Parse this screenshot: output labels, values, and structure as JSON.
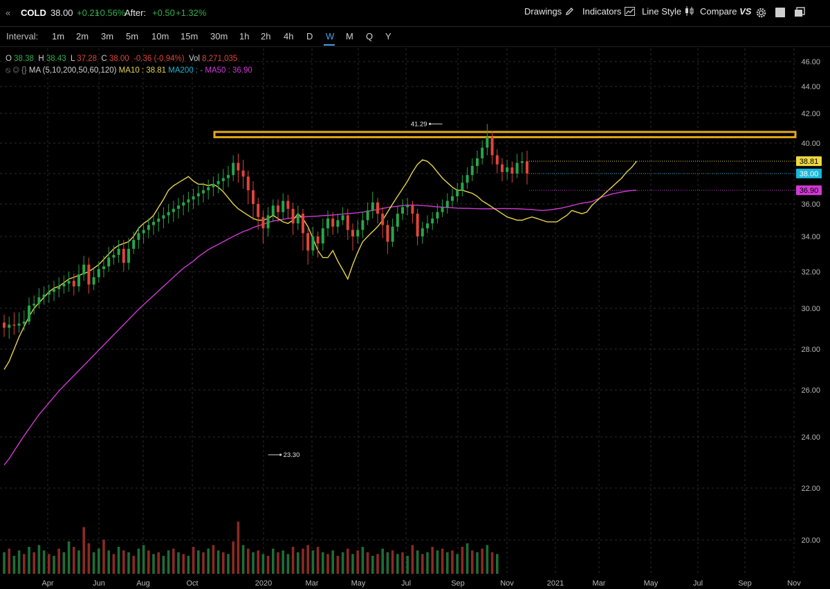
{
  "header": {
    "back_glyph": "«",
    "symbol": "COLD",
    "price": "38.00",
    "change": "+0.21",
    "change_pct": "+0.56%",
    "after_label": "After:",
    "after_change": "+0.50",
    "after_pct": "+1.32%",
    "buttons": {
      "drawings": "Drawings",
      "indicators": "Indicators",
      "line_style": "Line Style",
      "compare": "Compare",
      "compare_suffix": "VS"
    }
  },
  "intervals": {
    "label": "Interval:",
    "items": [
      "1m",
      "2m",
      "3m",
      "5m",
      "10m",
      "15m",
      "30m",
      "1h",
      "2h",
      "4h",
      "D",
      "W",
      "M",
      "Q",
      "Y"
    ],
    "active": "W"
  },
  "ohlc": {
    "o_label": "O",
    "o": "38.38",
    "h_label": "H",
    "h": "38.43",
    "l_label": "L",
    "l": "37.28",
    "c_label": "C",
    "c": "38.00",
    "chg": "-0.36 (-0.94%)",
    "vol_label": "Vol",
    "vol": "8,271,035"
  },
  "ma_line": {
    "icons": "⦸ ◎ {}",
    "ma_def": "MA (5,10,200,50,60,120)",
    "ma10": "MA10 : 38.81",
    "ma200": "MA200 : -",
    "ma50": "MA50 : 36.90"
  },
  "colors": {
    "up": "#26a64a",
    "down": "#e0453a",
    "ma10": "#e8d44d",
    "ma50": "#d23ad6",
    "resistance": "#e6a817",
    "last_price": "#17b8d8",
    "ma10_tag": "#f0d840"
  },
  "chart_data": {
    "type": "candlestick",
    "symbol": "COLD",
    "interval": "W",
    "ylim": [
      19.2,
      46.5
    ],
    "y_ticks": [
      20,
      22,
      24,
      26,
      28,
      30,
      32,
      34,
      36,
      38,
      40,
      42,
      44,
      46
    ],
    "y_tick_labels": [
      "20.00",
      "22.00",
      "24.00",
      "26.00",
      "28.00",
      "30.00",
      "32.00",
      "34.00",
      "36.00",
      "38.00",
      "40.00",
      "42.00",
      "44.00",
      "46.00"
    ],
    "x_labels": [
      "Apr",
      "Jun",
      "Aug",
      "Oct",
      "2020",
      "Mar",
      "May",
      "Jul",
      "Sep",
      "Nov",
      "2021",
      "Mar",
      "May",
      "Jul",
      "Sep",
      "Nov"
    ],
    "grid": true,
    "annotations": [
      {
        "text": "41.29",
        "value": 41.29,
        "type": "high"
      },
      {
        "text": "23.30",
        "value": 23.3,
        "type": "low"
      }
    ],
    "price_tags": [
      {
        "text": "38.81",
        "value": 38.81,
        "series": "MA10"
      },
      {
        "text": "38.00",
        "value": 38.0,
        "series": "last"
      },
      {
        "text": "36.90",
        "value": 36.9,
        "series": "MA50"
      }
    ],
    "resistance_band": [
      40.4,
      40.75
    ],
    "ma10": [
      27.0,
      27.4,
      28.0,
      28.6,
      29.1,
      29.6,
      30.0,
      30.3,
      30.6,
      30.9,
      31.1,
      31.2,
      31.4,
      31.6,
      31.7,
      31.8,
      31.9,
      32.0,
      32.2,
      32.4,
      32.7,
      33.0,
      33.3,
      33.5,
      33.6,
      33.7,
      34.0,
      34.5,
      34.8,
      35.0,
      35.3,
      35.8,
      36.3,
      36.9,
      37.2,
      37.4,
      37.6,
      37.8,
      37.5,
      37.3,
      37.3,
      37.2,
      37.3,
      37.1,
      36.8,
      36.4,
      36.0,
      35.7,
      35.5,
      35.3,
      35.1,
      35.0,
      35.0,
      35.1,
      35.3,
      35.1,
      34.9,
      34.8,
      35.0,
      35.4,
      35.1,
      34.6,
      33.9,
      33.2,
      32.8,
      32.8,
      33.2,
      32.6,
      32.1,
      31.6,
      32.4,
      33.1,
      33.7,
      34.0,
      34.3,
      34.6,
      35.0,
      35.5,
      36.0,
      36.5,
      37.0,
      37.5,
      38.1,
      38.6,
      38.9,
      38.8,
      38.5,
      38.1,
      37.7,
      37.4,
      37.1,
      36.9,
      36.9,
      36.8,
      36.7,
      36.5,
      36.2,
      36.0,
      35.8,
      35.6,
      35.4,
      35.2,
      35.1,
      35.0,
      35.0,
      35.1,
      35.2,
      35.1,
      35.0,
      34.9,
      34.9,
      34.9,
      35.1,
      35.3,
      35.6,
      35.5,
      35.4,
      35.5,
      35.9,
      36.2,
      36.5,
      36.8,
      37.1,
      37.4,
      37.7,
      38.1,
      38.4,
      38.81
    ],
    "ma50": [
      22.9,
      23.15,
      23.45,
      23.75,
      24.05,
      24.35,
      24.65,
      24.95,
      25.2,
      25.45,
      25.7,
      25.95,
      26.2,
      26.45,
      26.7,
      26.95,
      27.2,
      27.45,
      27.7,
      27.95,
      28.2,
      28.45,
      28.7,
      28.95,
      29.2,
      29.45,
      29.7,
      29.95,
      30.2,
      30.45,
      30.7,
      30.95,
      31.2,
      31.45,
      31.7,
      31.95,
      32.2,
      32.4,
      32.6,
      32.85,
      33.05,
      33.25,
      33.4,
      33.55,
      33.7,
      33.85,
      34.0,
      34.15,
      34.3,
      34.4,
      34.55,
      34.65,
      34.75,
      34.85,
      34.95,
      35.0,
      35.05,
      35.1,
      35.15,
      35.18,
      35.2,
      35.22,
      35.24,
      35.25,
      35.28,
      35.3,
      35.32,
      35.35,
      35.38,
      35.4,
      35.43,
      35.46,
      35.5,
      35.55,
      35.6,
      35.66,
      35.72,
      35.78,
      35.82,
      35.86,
      35.9,
      35.92,
      35.93,
      35.92,
      35.9,
      35.88,
      35.85,
      35.82,
      35.8,
      35.78,
      35.76,
      35.74,
      35.73,
      35.73,
      35.72,
      35.71,
      35.7,
      35.7,
      35.7,
      35.71,
      35.72,
      35.72,
      35.71,
      35.7,
      35.69,
      35.67,
      35.65,
      35.62,
      35.6,
      35.62,
      35.65,
      35.7,
      35.75,
      35.82,
      35.9,
      35.98,
      36.05,
      36.1,
      36.15,
      36.3,
      36.45,
      36.55,
      36.65,
      36.72,
      36.78,
      36.84,
      36.88,
      36.9
    ],
    "candles": [
      [
        29.3,
        29.05,
        29.7,
        28.6
      ],
      [
        29.05,
        29.2,
        29.6,
        28.5
      ],
      [
        29.2,
        29.15,
        29.8,
        28.7
      ],
      [
        29.15,
        29.25,
        29.8,
        28.8
      ],
      [
        29.25,
        29.35,
        29.9,
        28.9
      ],
      [
        29.35,
        30.15,
        30.6,
        29.2
      ],
      [
        30.15,
        30.25,
        30.7,
        29.7
      ],
      [
        30.25,
        30.6,
        31.1,
        30.0
      ],
      [
        30.6,
        30.75,
        31.2,
        30.2
      ],
      [
        30.75,
        30.9,
        31.3,
        30.3
      ],
      [
        30.9,
        31.05,
        31.5,
        30.4
      ],
      [
        31.05,
        31.2,
        31.7,
        30.6
      ],
      [
        31.2,
        31.35,
        31.8,
        30.8
      ],
      [
        31.35,
        31.5,
        32.0,
        30.9
      ],
      [
        31.5,
        31.2,
        31.9,
        30.7
      ],
      [
        31.2,
        31.85,
        32.4,
        30.9
      ],
      [
        31.85,
        32.4,
        32.9,
        31.5
      ],
      [
        32.4,
        31.3,
        32.8,
        30.8
      ],
      [
        31.3,
        31.7,
        32.2,
        31.0
      ],
      [
        31.7,
        32.15,
        32.6,
        31.4
      ],
      [
        32.15,
        32.3,
        32.9,
        31.7
      ],
      [
        32.3,
        32.8,
        33.4,
        32.0
      ],
      [
        32.8,
        32.95,
        33.5,
        32.4
      ],
      [
        32.95,
        33.3,
        33.8,
        32.5
      ],
      [
        33.3,
        32.5,
        33.8,
        32.0
      ],
      [
        32.5,
        33.3,
        33.9,
        32.1
      ],
      [
        33.3,
        33.8,
        34.3,
        33.0
      ],
      [
        33.8,
        34.2,
        34.6,
        33.3
      ],
      [
        34.2,
        34.4,
        34.8,
        33.6
      ],
      [
        34.4,
        34.7,
        35.1,
        33.9
      ],
      [
        34.7,
        34.9,
        35.3,
        34.1
      ],
      [
        34.9,
        35.1,
        35.5,
        34.3
      ],
      [
        35.1,
        35.3,
        35.8,
        34.5
      ],
      [
        35.3,
        35.5,
        36.0,
        34.8
      ],
      [
        35.5,
        35.7,
        36.2,
        34.9
      ],
      [
        35.7,
        35.9,
        36.4,
        35.1
      ],
      [
        35.9,
        36.1,
        36.6,
        35.3
      ],
      [
        36.1,
        36.3,
        36.8,
        35.5
      ],
      [
        36.3,
        36.5,
        37.0,
        35.7
      ],
      [
        36.5,
        36.7,
        37.2,
        35.9
      ],
      [
        36.7,
        36.9,
        37.4,
        36.1
      ],
      [
        36.9,
        37.1,
        37.6,
        36.3
      ],
      [
        37.1,
        37.3,
        37.8,
        36.5
      ],
      [
        37.3,
        37.5,
        38.0,
        36.7
      ],
      [
        37.5,
        37.7,
        38.3,
        36.9
      ],
      [
        37.7,
        37.9,
        38.5,
        37.1
      ],
      [
        37.9,
        38.7,
        39.2,
        37.5
      ],
      [
        38.7,
        38.2,
        39.3,
        37.4
      ],
      [
        38.2,
        37.8,
        38.9,
        37.0
      ],
      [
        37.8,
        36.9,
        38.2,
        36.0
      ],
      [
        36.9,
        36.0,
        37.5,
        35.0
      ],
      [
        36.0,
        35.2,
        36.4,
        34.4
      ],
      [
        35.2,
        34.5,
        35.6,
        33.6
      ],
      [
        34.5,
        35.3,
        35.8,
        34.0
      ],
      [
        35.3,
        35.9,
        36.3,
        34.9
      ],
      [
        35.9,
        35.5,
        36.3,
        34.9
      ],
      [
        35.5,
        36.2,
        36.7,
        35.0
      ],
      [
        36.2,
        35.7,
        36.6,
        35.1
      ],
      [
        35.7,
        34.8,
        36.1,
        34.1
      ],
      [
        34.8,
        35.4,
        35.9,
        34.4
      ],
      [
        35.4,
        34.2,
        35.7,
        33.2
      ],
      [
        34.2,
        33.2,
        34.5,
        32.4
      ],
      [
        33.2,
        34.0,
        34.6,
        32.9
      ],
      [
        34.0,
        33.6,
        34.3,
        32.8
      ],
      [
        33.6,
        34.5,
        35.1,
        33.2
      ],
      [
        34.5,
        35.1,
        35.6,
        34.0
      ],
      [
        35.1,
        34.6,
        35.5,
        34.1
      ],
      [
        34.6,
        35.0,
        35.4,
        34.2
      ],
      [
        35.0,
        35.3,
        35.8,
        34.7
      ],
      [
        35.3,
        34.4,
        35.7,
        33.8
      ],
      [
        34.4,
        34.0,
        34.8,
        33.2
      ],
      [
        34.0,
        34.4,
        35.0,
        33.6
      ],
      [
        34.4,
        35.0,
        35.5,
        33.9
      ],
      [
        35.0,
        35.6,
        36.1,
        34.7
      ],
      [
        35.6,
        36.1,
        36.8,
        35.1
      ],
      [
        36.1,
        35.4,
        36.4,
        34.8
      ],
      [
        35.4,
        34.7,
        35.8,
        33.9
      ],
      [
        34.7,
        33.7,
        35.0,
        33.0
      ],
      [
        33.7,
        34.6,
        35.1,
        33.4
      ],
      [
        34.6,
        35.4,
        35.9,
        34.3
      ],
      [
        35.4,
        35.8,
        36.3,
        35.0
      ],
      [
        35.8,
        35.9,
        36.4,
        35.3
      ],
      [
        35.9,
        35.4,
        36.2,
        34.8
      ],
      [
        35.4,
        34.0,
        35.7,
        33.5
      ],
      [
        34.0,
        34.5,
        34.9,
        33.6
      ],
      [
        34.5,
        34.8,
        35.3,
        34.2
      ],
      [
        34.8,
        35.1,
        35.5,
        34.4
      ],
      [
        35.1,
        35.5,
        36.0,
        34.8
      ],
      [
        35.5,
        35.8,
        36.3,
        35.2
      ],
      [
        35.8,
        36.2,
        36.7,
        35.4
      ],
      [
        36.2,
        36.5,
        37.0,
        35.8
      ],
      [
        36.5,
        36.9,
        37.4,
        36.1
      ],
      [
        36.9,
        37.4,
        37.9,
        36.5
      ],
      [
        37.4,
        37.9,
        38.4,
        37.0
      ],
      [
        37.9,
        38.5,
        39.0,
        37.5
      ],
      [
        38.5,
        39.0,
        39.5,
        38.0
      ],
      [
        39.0,
        39.7,
        40.2,
        38.6
      ],
      [
        39.7,
        40.4,
        41.29,
        39.2
      ],
      [
        40.4,
        39.2,
        40.8,
        38.6
      ],
      [
        39.2,
        38.6,
        39.6,
        38.0
      ],
      [
        38.6,
        38.1,
        39.0,
        37.5
      ],
      [
        38.1,
        38.4,
        38.9,
        37.6
      ],
      [
        38.4,
        38.0,
        38.8,
        37.4
      ],
      [
        38.0,
        38.7,
        39.3,
        37.7
      ],
      [
        38.7,
        38.81,
        39.4,
        38.0
      ],
      [
        38.81,
        38.0,
        39.5,
        37.28
      ]
    ],
    "volume": [
      [
        0,
        1.2
      ],
      [
        1,
        1.4
      ],
      [
        0,
        1.0
      ],
      [
        0,
        1.3
      ],
      [
        1,
        1.1
      ],
      [
        0,
        1.5
      ],
      [
        1,
        1.2
      ],
      [
        0,
        1.6
      ],
      [
        0,
        1.3
      ],
      [
        1,
        1.1
      ],
      [
        0,
        1.0
      ],
      [
        1,
        1.4
      ],
      [
        0,
        1.2
      ],
      [
        0,
        1.8
      ],
      [
        1,
        1.5
      ],
      [
        0,
        1.3
      ],
      [
        1,
        2.6
      ],
      [
        1,
        1.7
      ],
      [
        0,
        1.2
      ],
      [
        0,
        1.4
      ],
      [
        1,
        1.9
      ],
      [
        0,
        1.3
      ],
      [
        1,
        1.1
      ],
      [
        0,
        1.5
      ],
      [
        1,
        1.3
      ],
      [
        0,
        1.2
      ],
      [
        1,
        1.0
      ],
      [
        0,
        1.4
      ],
      [
        0,
        1.6
      ],
      [
        1,
        1.3
      ],
      [
        0,
        1.1
      ],
      [
        1,
        1.2
      ],
      [
        0,
        1.0
      ],
      [
        0,
        1.3
      ],
      [
        1,
        1.4
      ],
      [
        0,
        1.2
      ],
      [
        1,
        1.1
      ],
      [
        0,
        1.0
      ],
      [
        1,
        1.5
      ],
      [
        0,
        1.3
      ],
      [
        1,
        1.2
      ],
      [
        0,
        1.4
      ],
      [
        1,
        1.6
      ],
      [
        0,
        1.3
      ],
      [
        1,
        1.2
      ],
      [
        0,
        1.1
      ],
      [
        1,
        1.8
      ],
      [
        1,
        2.9
      ],
      [
        0,
        1.6
      ],
      [
        1,
        1.4
      ],
      [
        0,
        1.2
      ],
      [
        1,
        1.3
      ],
      [
        0,
        1.1
      ],
      [
        1,
        1.0
      ],
      [
        0,
        1.4
      ],
      [
        1,
        1.2
      ],
      [
        0,
        1.3
      ],
      [
        0,
        1.1
      ],
      [
        1,
        1.5
      ],
      [
        0,
        1.2
      ],
      [
        1,
        1.4
      ],
      [
        1,
        1.6
      ],
      [
        0,
        1.3
      ],
      [
        1,
        1.5
      ],
      [
        0,
        1.2
      ],
      [
        1,
        1.1
      ],
      [
        0,
        1.3
      ],
      [
        1,
        1.0
      ],
      [
        0,
        1.2
      ],
      [
        1,
        1.4
      ],
      [
        0,
        1.1
      ],
      [
        1,
        1.3
      ],
      [
        0,
        1.5
      ],
      [
        1,
        1.2
      ],
      [
        0,
        1.0
      ],
      [
        1,
        1.1
      ],
      [
        0,
        1.4
      ],
      [
        0,
        1.2
      ],
      [
        1,
        1.3
      ],
      [
        0,
        1.1
      ],
      [
        1,
        1.2
      ],
      [
        0,
        1.0
      ],
      [
        1,
        1.6
      ],
      [
        0,
        1.3
      ],
      [
        1,
        1.1
      ],
      [
        0,
        1.2
      ],
      [
        1,
        1.5
      ],
      [
        0,
        1.3
      ],
      [
        1,
        1.4
      ],
      [
        0,
        1.2
      ],
      [
        1,
        1.3
      ],
      [
        0,
        1.1
      ],
      [
        1,
        1.5
      ],
      [
        0,
        1.7
      ],
      [
        1,
        1.3
      ],
      [
        0,
        1.2
      ],
      [
        1,
        1.4
      ],
      [
        0,
        1.6
      ],
      [
        1,
        1.2
      ],
      [
        0,
        1.1
      ]
    ]
  }
}
